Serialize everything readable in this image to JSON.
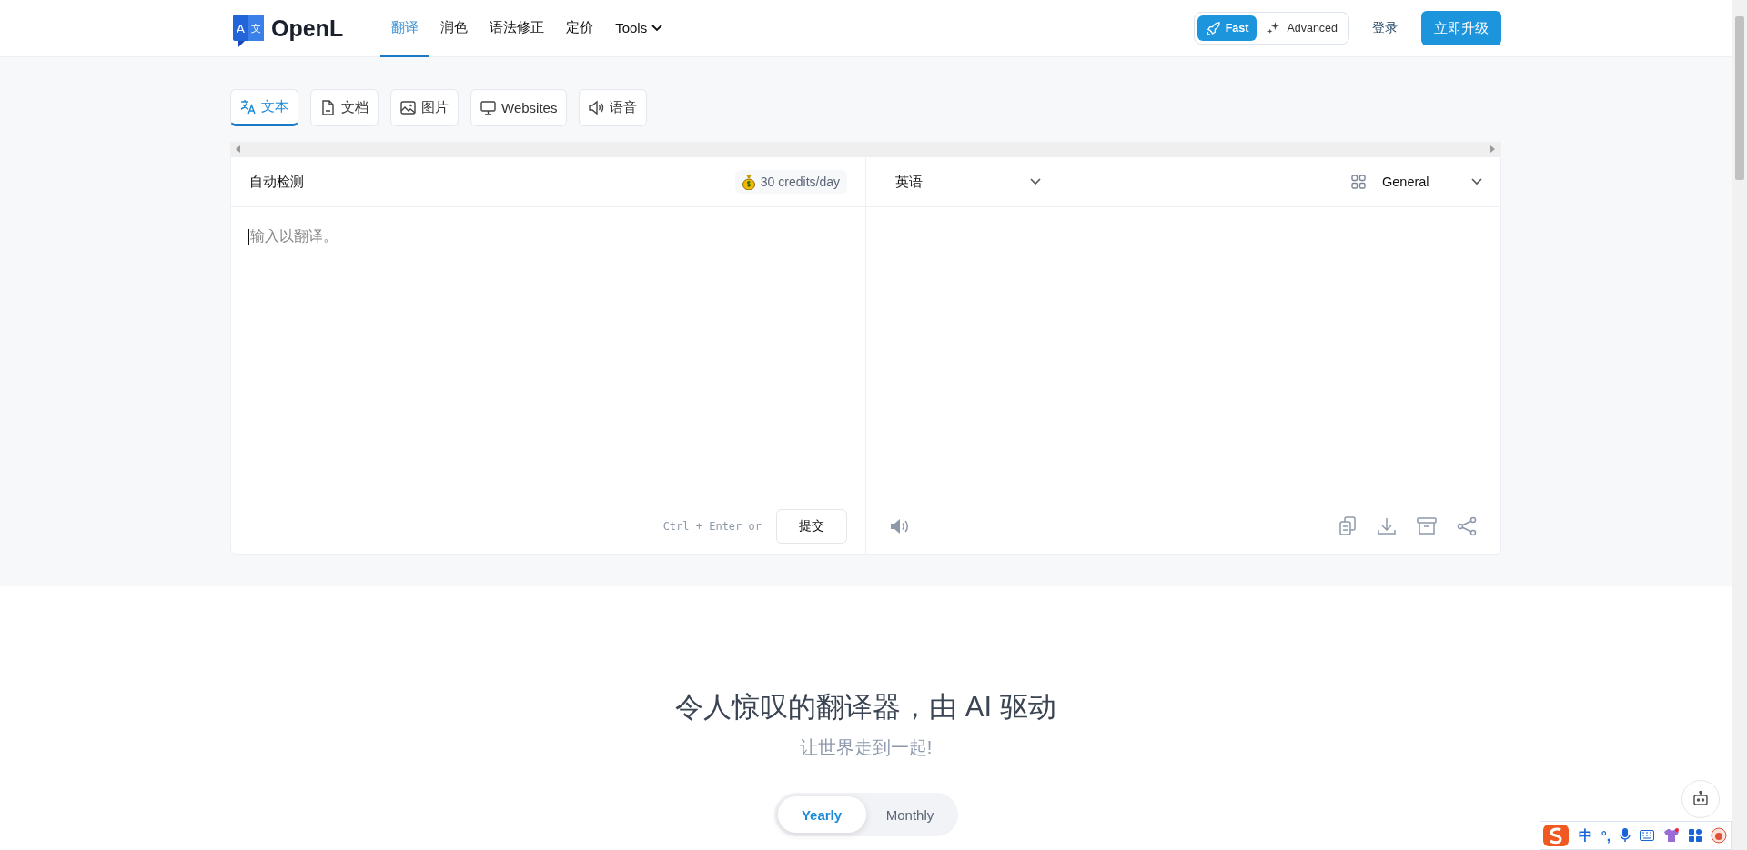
{
  "header": {
    "logo_mark": [
      "A",
      "文"
    ],
    "logo_text": "OpenL",
    "nav": [
      {
        "label": "翻译",
        "kind": "link",
        "selected": true
      },
      {
        "label": "润色",
        "kind": "link",
        "selected": false
      },
      {
        "label": "语法修正",
        "kind": "link",
        "selected": false
      },
      {
        "label": "定价",
        "kind": "link",
        "selected": false
      },
      {
        "label": "Tools",
        "kind": "menu",
        "selected": false
      }
    ],
    "mode_toggle": [
      {
        "label": "Fast",
        "selected": true
      },
      {
        "label": "Advanced",
        "selected": false
      }
    ],
    "login": "登录",
    "upgrade": "立即升级"
  },
  "input_tabs": [
    {
      "label": "文本",
      "selected": true
    },
    {
      "label": "文档",
      "selected": false
    },
    {
      "label": "图片",
      "selected": false
    },
    {
      "label": "Websites",
      "selected": false
    },
    {
      "label": "语音",
      "selected": false
    }
  ],
  "translator": {
    "source_language": "自动检测",
    "credits": "30 credits/day",
    "placeholder": "输入以翻译。",
    "shortcut_keys": [
      "Ctrl",
      "+",
      "Enter"
    ],
    "shortcut_or": "or",
    "submit": "提交",
    "target_language": "英语",
    "domain": "General"
  },
  "hero": {
    "title": "令人惊叹的翻译器，由 AI 驱动",
    "subtitle": "让世界走到一起!"
  },
  "billing_toggle": [
    {
      "label": "Yearly",
      "selected": true
    },
    {
      "label": "Monthly",
      "selected": false
    }
  ],
  "ime_toolbar": {
    "mode": "中",
    "punctuation": "°,"
  }
}
